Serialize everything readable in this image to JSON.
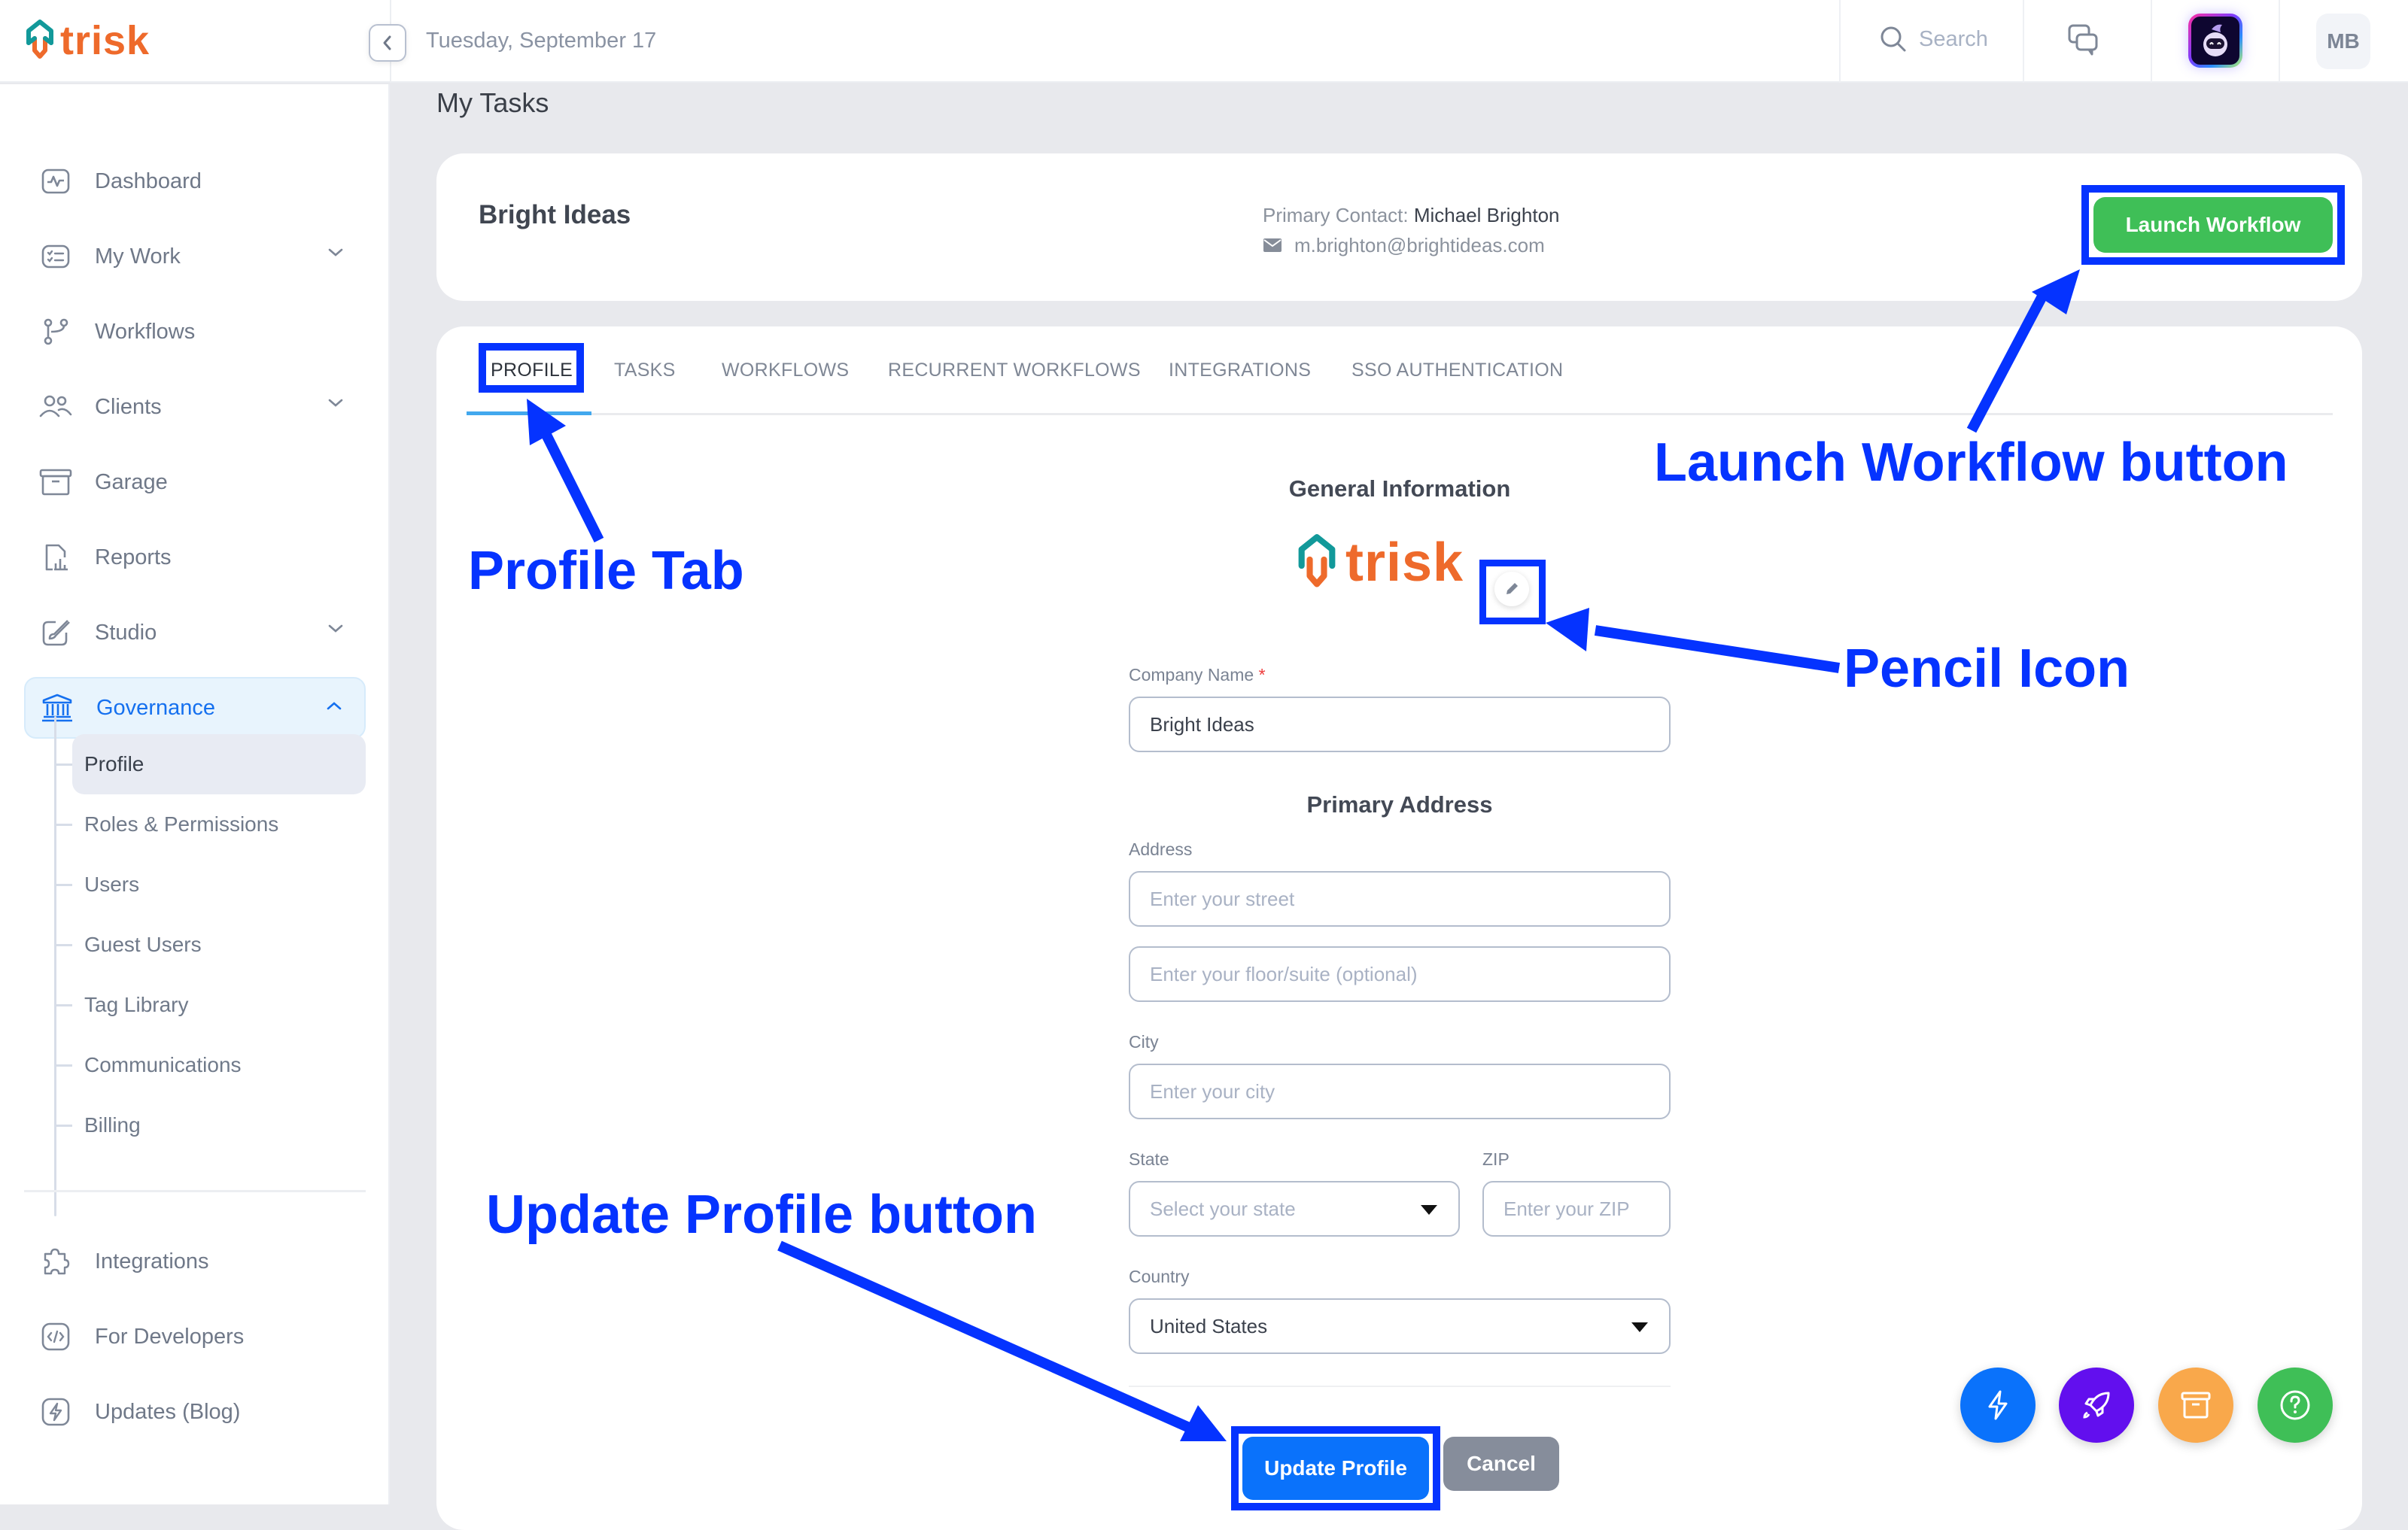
{
  "app": {
    "brand": "trisk",
    "date": "Tuesday, September 17"
  },
  "topbar": {
    "search_placeholder": "Search",
    "avatar_initials": "MB",
    "colors": {
      "brand_teal": "#12999a",
      "brand_orange": "#ee6a2b"
    }
  },
  "sidebar": {
    "items": [
      {
        "label": "Dashboard",
        "icon": "activity-icon",
        "has_chevron": false
      },
      {
        "label": "My Work",
        "icon": "checklist-icon",
        "has_chevron": true
      },
      {
        "label": "Workflows",
        "icon": "git-branch-icon",
        "has_chevron": false
      },
      {
        "label": "Clients",
        "icon": "users-icon",
        "has_chevron": true
      },
      {
        "label": "Garage",
        "icon": "archive-icon",
        "has_chevron": false
      },
      {
        "label": "Reports",
        "icon": "report-icon",
        "has_chevron": false
      },
      {
        "label": "Studio",
        "icon": "brush-icon",
        "has_chevron": true
      },
      {
        "label": "Governance",
        "icon": "bank-icon",
        "has_chevron": true,
        "expanded": true,
        "active": true
      }
    ],
    "governance_sub": [
      {
        "label": "Profile",
        "active": true
      },
      {
        "label": "Roles & Permissions"
      },
      {
        "label": "Users"
      },
      {
        "label": "Guest Users"
      },
      {
        "label": "Tag Library"
      },
      {
        "label": "Communications"
      },
      {
        "label": "Billing"
      }
    ],
    "bottom_items": [
      {
        "label": "Integrations",
        "icon": "puzzle-icon"
      },
      {
        "label": "For Developers",
        "icon": "code-icon"
      },
      {
        "label": "Updates (Blog)",
        "icon": "bolt-icon"
      }
    ]
  },
  "main": {
    "page_title": "My Tasks",
    "header": {
      "company": "Bright Ideas",
      "contact_label": "Primary Contact:",
      "contact_name": "Michael Brighton",
      "contact_email": "m.brighton@brightideas.com",
      "launch_label": "Launch Workflow"
    },
    "tabs": [
      {
        "label": "PROFILE",
        "active": true
      },
      {
        "label": "TASKS"
      },
      {
        "label": "WORKFLOWS"
      },
      {
        "label": "RECURRENT WORKFLOWS"
      },
      {
        "label": "INTEGRATIONS"
      },
      {
        "label": "SSO AUTHENTICATION"
      }
    ],
    "form": {
      "general_title": "General Information",
      "logo_text": "trisk",
      "company_name_label": "Company Name",
      "required_mark": "*",
      "company_name_value": "Bright Ideas",
      "address_title": "Primary Address",
      "address_label": "Address",
      "street_placeholder": "Enter your street",
      "suite_placeholder": "Enter your floor/suite (optional)",
      "city_label": "City",
      "city_placeholder": "Enter your city",
      "state_label": "State",
      "state_placeholder": "Select your state",
      "zip_label": "ZIP",
      "zip_placeholder": "Enter your ZIP",
      "country_label": "Country",
      "country_value": "United States",
      "update_label": "Update Profile",
      "cancel_label": "Cancel"
    },
    "fabs": [
      {
        "name": "quick-actions",
        "icon": "bolt-icon",
        "color": "#0a72fb"
      },
      {
        "name": "launch",
        "icon": "rocket-icon",
        "color": "#620fee"
      },
      {
        "name": "archive",
        "icon": "archive-icon",
        "color": "#f9a84b"
      },
      {
        "name": "help",
        "icon": "help-icon",
        "color": "#3fbf57"
      }
    ]
  },
  "annotations": {
    "profile_tab": "Profile Tab",
    "launch_workflow": "Launch Workflow button",
    "pencil_icon": "Pencil Icon",
    "update_profile": "Update Profile button",
    "color": "#0533ff"
  }
}
